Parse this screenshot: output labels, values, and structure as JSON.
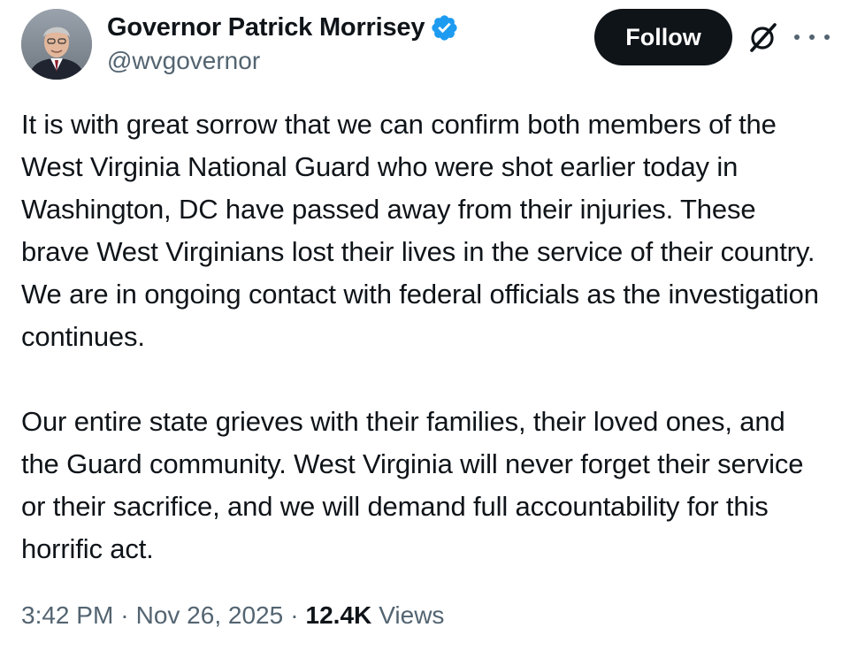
{
  "author": {
    "display_name": "Governor Patrick Morrisey",
    "handle": "@wvgovernor",
    "verified": true,
    "avatar_icon": "profile-photo"
  },
  "actions": {
    "follow_label": "Follow",
    "grok_icon": "grok-slash-icon",
    "more_icon": "more-dots-icon"
  },
  "tweet": {
    "paragraphs": [
      "It is with great sorrow that we can confirm both members of the West Virginia National Guard who were shot earlier today in Washington, DC have passed away from their injuries. These brave West Virginians lost their lives in the service of their country. We are in ongoing contact with federal officials as the investigation continues.",
      "Our entire state grieves with their families, their loved ones, and the Guard community. West Virginia will never forget their service or their sacrifice, and we will demand full accountability for this horrific act."
    ]
  },
  "meta": {
    "time": "3:42 PM",
    "separator": "·",
    "date": "Nov 26, 2025",
    "views_count": "12.4K",
    "views_label": "Views"
  },
  "colors": {
    "text_primary": "#0f1419",
    "text_secondary": "#536471",
    "verified_blue": "#1d9bf0",
    "follow_bg": "#0f1419"
  }
}
